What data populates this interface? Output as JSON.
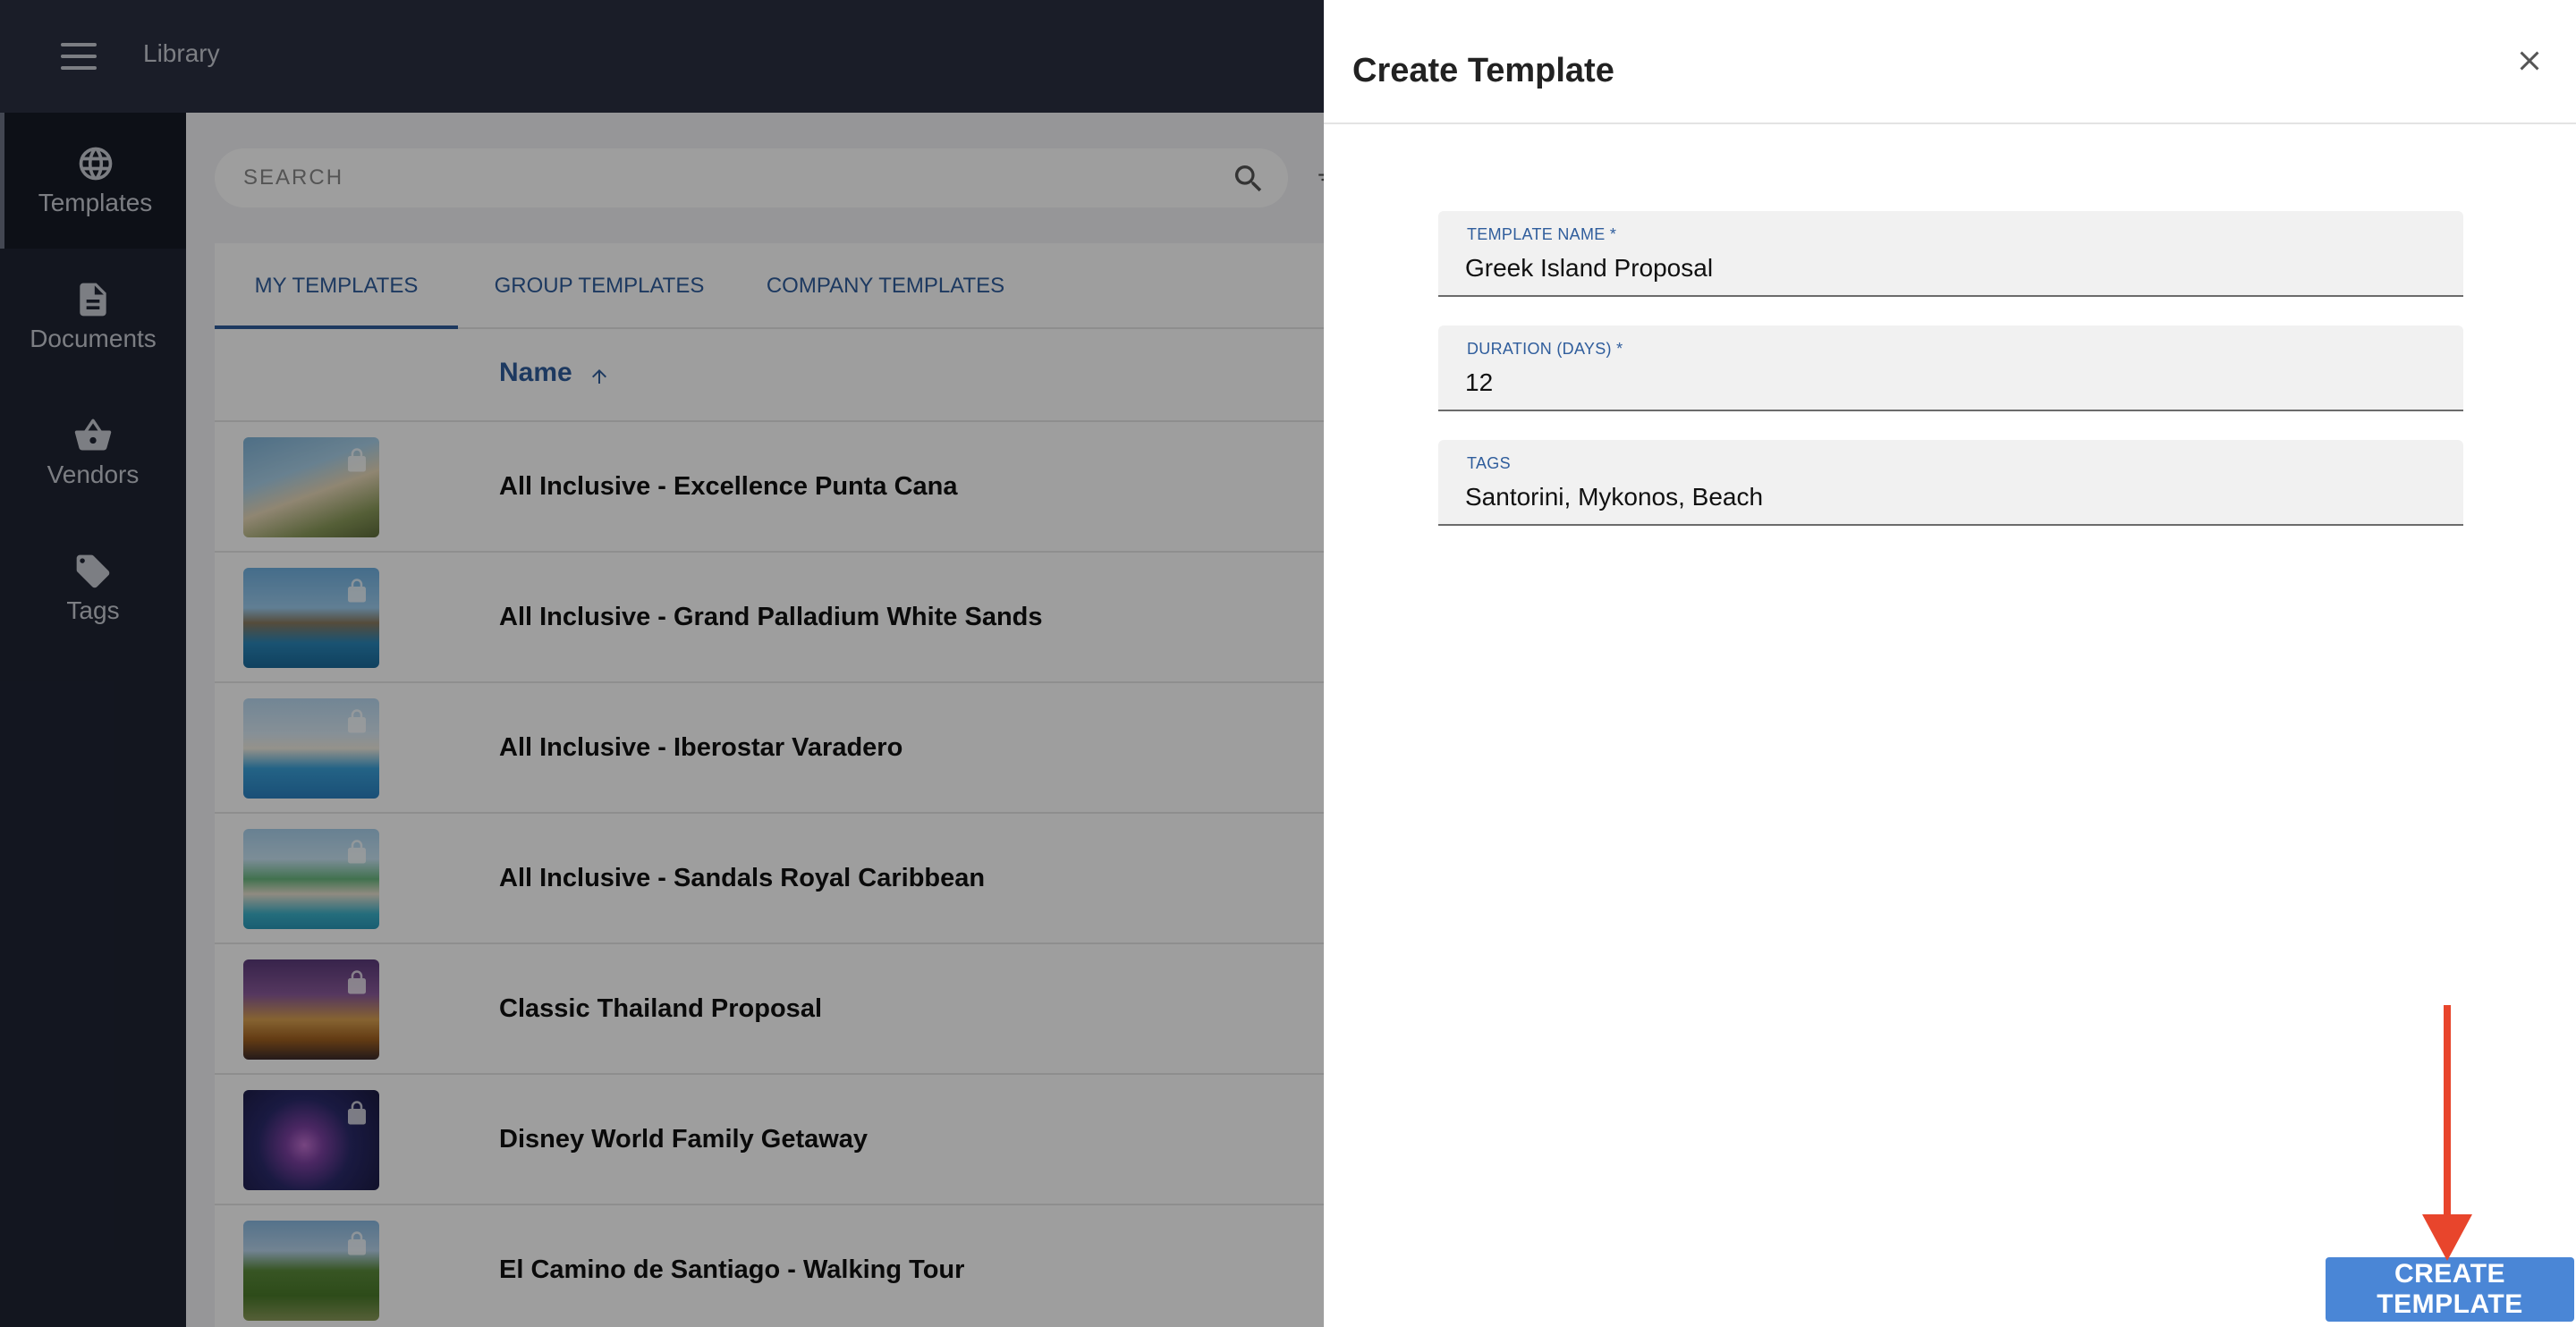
{
  "app": {
    "title": "Library"
  },
  "sidebar": {
    "items": [
      {
        "label": "Templates",
        "icon": "globe-icon"
      },
      {
        "label": "Documents",
        "icon": "document-icon"
      },
      {
        "label": "Vendors",
        "icon": "basket-icon"
      },
      {
        "label": "Tags",
        "icon": "tag-icon"
      }
    ]
  },
  "search": {
    "placeholder": "SEARCH"
  },
  "tabs": [
    {
      "label": "MY TEMPLATES"
    },
    {
      "label": "GROUP TEMPLATES"
    },
    {
      "label": "COMPANY TEMPLATES"
    }
  ],
  "table": {
    "column_name": "Name",
    "rows": [
      {
        "name": "All Inclusive - Excellence Punta Cana"
      },
      {
        "name": "All Inclusive - Grand Palladium White Sands"
      },
      {
        "name": "All Inclusive - Iberostar Varadero"
      },
      {
        "name": "All Inclusive - Sandals Royal Caribbean"
      },
      {
        "name": "Classic Thailand Proposal"
      },
      {
        "name": "Disney World Family Getaway"
      },
      {
        "name": "El Camino de Santiago - Walking Tour"
      }
    ]
  },
  "drawer": {
    "title": "Create Template",
    "fields": {
      "template_name": {
        "label": "TEMPLATE NAME *",
        "value": "Greek Island Proposal"
      },
      "duration": {
        "label": "DURATION (DAYS) *",
        "value": "12"
      },
      "tags": {
        "label": "TAGS",
        "value": "Santorini, Mykonos, Beach"
      }
    },
    "create_button": "CREATE TEMPLATE"
  },
  "colors": {
    "accent": "#2f5d9c",
    "button": "#4a86d6",
    "annotation_arrow": "#e8452c",
    "sidebar": "#1f2433"
  }
}
